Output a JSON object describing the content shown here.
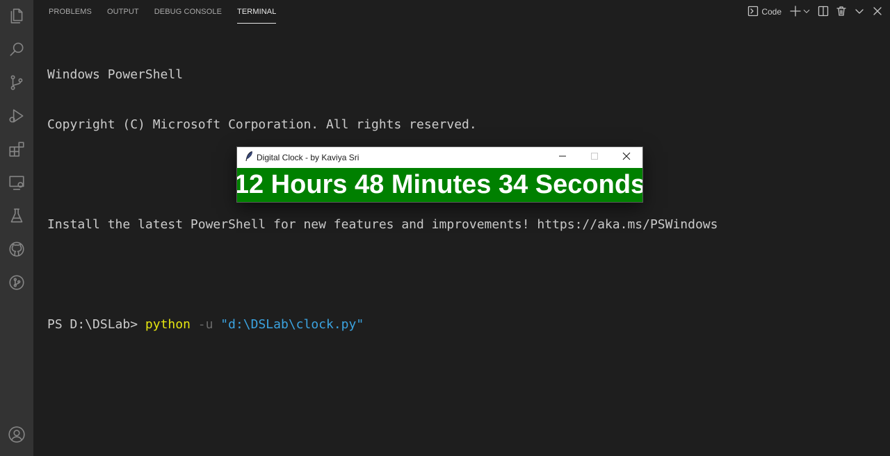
{
  "panel": {
    "tabs": [
      {
        "label": "PROBLEMS"
      },
      {
        "label": "OUTPUT"
      },
      {
        "label": "DEBUG CONSOLE"
      },
      {
        "label": "TERMINAL",
        "active": true
      }
    ],
    "toolbar": {
      "terminal_name": "Code",
      "icons": [
        "terminal-icon",
        "plus-icon",
        "chevron-down-icon",
        "split-icon",
        "trash-icon",
        "chevron-down-icon",
        "close-icon"
      ]
    }
  },
  "activity_bar": {
    "icons": [
      "explorer-icon",
      "search-icon",
      "source-control-icon",
      "run-debug-icon",
      "extensions-icon",
      "remote-explorer-icon",
      "testing-icon",
      "github-icon",
      "git-graph-icon",
      "account-icon"
    ]
  },
  "terminal": {
    "line1": "Windows PowerShell",
    "line2": "Copyright (C) Microsoft Corporation. All rights reserved.",
    "line3": "Install the latest PowerShell for new features and improvements! https://aka.ms/PSWindows",
    "prompt": "PS D:\\DSLab> ",
    "command": "python",
    "param": " -u ",
    "argument": "\"d:\\DSLab\\clock.py\""
  },
  "clock_window": {
    "title": "Digital Clock - by Kaviya Sri",
    "display": "12 Hours 48 Minutes 34 Seconds"
  },
  "colors": {
    "editor_bg": "#1e1e1e",
    "activity_bg": "#333333",
    "clock_bg": "#008000",
    "command": "#e5e510",
    "string": "#3ba3e0"
  }
}
